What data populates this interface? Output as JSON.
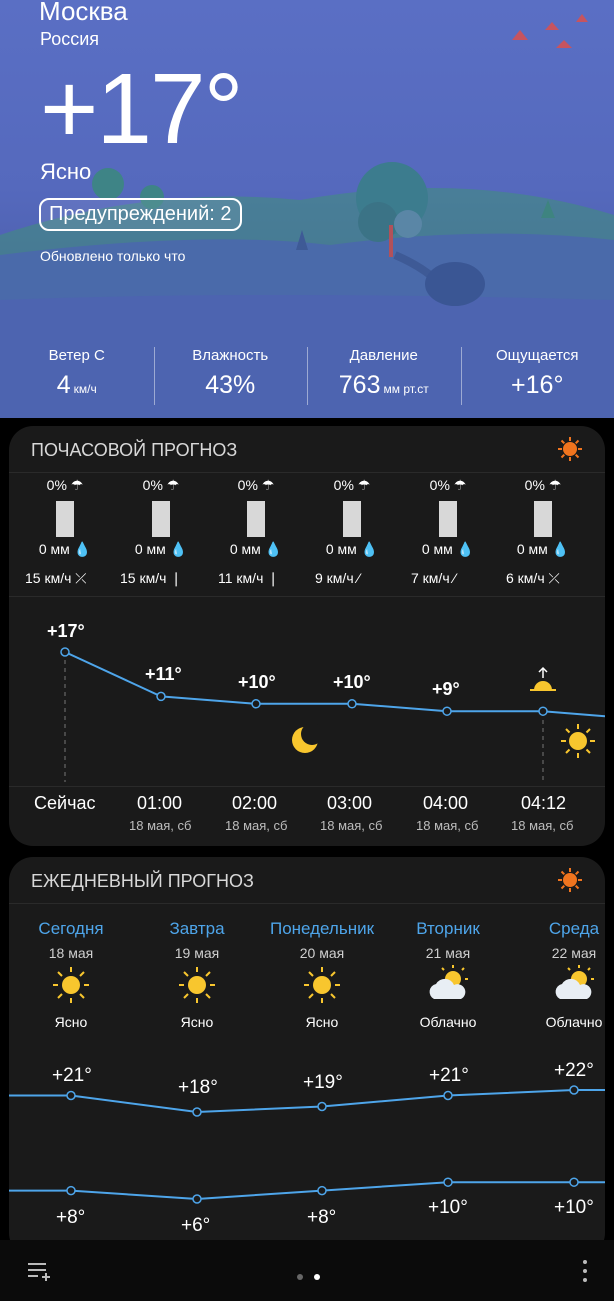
{
  "location": {
    "city": "Москва",
    "country": "Россия"
  },
  "current": {
    "temp": "+17°",
    "condition": "Ясно",
    "warnings": "Предупреждений: 2",
    "updated": "Обновлено только что"
  },
  "stats": [
    {
      "label": "Ветер С",
      "value": "4",
      "unit": "км/ч"
    },
    {
      "label": "Влажность",
      "value": "43%",
      "unit": ""
    },
    {
      "label": "Давление",
      "value": "763",
      "unit": "мм рт.ст"
    },
    {
      "label": "Ощущается",
      "value": "+16°",
      "unit": ""
    }
  ],
  "hourly": {
    "title": "ПОЧАСОВОЙ ПРОГНОЗ",
    "columns": [
      {
        "precip": "0%",
        "amount": "0 мм",
        "wind": "15 км/ч",
        "temp": "+17°",
        "time": "Сейчас",
        "date": ""
      },
      {
        "precip": "0%",
        "amount": "0 мм",
        "wind": "15 км/ч",
        "temp": "+11°",
        "time": "01:00",
        "date": "18 мая, сб"
      },
      {
        "precip": "0%",
        "amount": "0 мм",
        "wind": "11 км/ч",
        "temp": "+10°",
        "time": "02:00",
        "date": "18 мая, сб"
      },
      {
        "precip": "0%",
        "amount": "0 мм",
        "wind": "9 км/ч",
        "temp": "+10°",
        "time": "03:00",
        "date": "18 мая, сб"
      },
      {
        "precip": "0%",
        "amount": "0 мм",
        "wind": "7 км/ч",
        "temp": "+9°",
        "time": "04:00",
        "date": "18 мая, сб"
      },
      {
        "precip": "0%",
        "amount": "0 мм",
        "wind": "6 км/ч",
        "temp": "",
        "time": "04:12",
        "date": "18 мая, сб"
      }
    ]
  },
  "daily": {
    "title": "ЕЖЕДНЕВНЫЙ ПРОГНОЗ",
    "days": [
      {
        "name": "Сегодня",
        "date": "18 мая",
        "condition": "Ясно",
        "icon": "sun-icon",
        "high": "+21°",
        "low": "+8°"
      },
      {
        "name": "Завтра",
        "date": "19 мая",
        "condition": "Ясно",
        "icon": "sun-icon",
        "high": "+18°",
        "low": "+6°"
      },
      {
        "name": "Понедельник",
        "date": "20 мая",
        "condition": "Ясно",
        "icon": "sun-icon",
        "high": "+19°",
        "low": "+8°"
      },
      {
        "name": "Вторник",
        "date": "21 мая",
        "condition": "Облачно",
        "icon": "partly-cloudy-icon",
        "high": "+21°",
        "low": "+10°"
      },
      {
        "name": "Среда",
        "date": "22 мая",
        "condition": "Облачно",
        "icon": "partly-cloudy-icon",
        "high": "+22°",
        "low": "+10°"
      }
    ]
  },
  "colors": {
    "accent": "#4ea5ea",
    "sun": "#f8c62e",
    "badge": "#f0741e",
    "card": "#1a1a1a"
  },
  "nav": {
    "menu_icon": "list-add-icon",
    "more_icon": "more-vert-icon",
    "page_dots": 2,
    "active_page": 2
  }
}
